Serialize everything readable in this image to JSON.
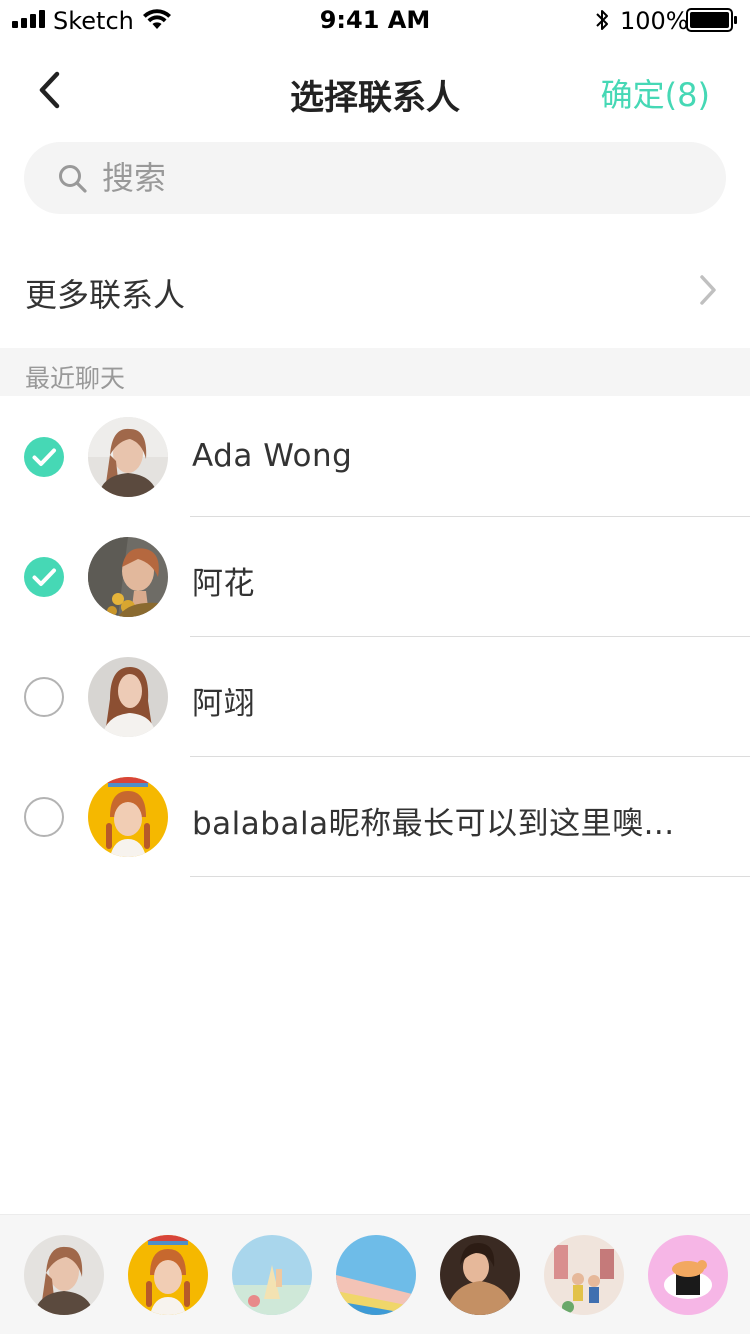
{
  "status_bar": {
    "carrier": "Sketch",
    "time": "9:41 AM",
    "battery_percent": "100%",
    "icons": [
      "signal-icon",
      "wifi-icon",
      "bluetooth-icon",
      "battery-icon"
    ]
  },
  "nav": {
    "title": "选择联系人",
    "confirm_label": "确定(8)",
    "back_icon": "back-arrow-icon"
  },
  "search": {
    "placeholder": "搜索",
    "value": ""
  },
  "more_contacts": {
    "label": "更多联系人"
  },
  "section": {
    "title": "最近聊天"
  },
  "contacts": [
    {
      "name": "Ada Wong",
      "checked": true
    },
    {
      "name": "阿花",
      "checked": true
    },
    {
      "name": "阿翊",
      "checked": false
    },
    {
      "name": "balabala昵称最长可以到这里噢...",
      "checked": false
    }
  ],
  "selected_count": 7,
  "colors": {
    "accent": "#46d8b5",
    "search_bg": "#f4f4f4",
    "section_bg": "#f5f5f5",
    "divider": "#dcdcdc"
  }
}
